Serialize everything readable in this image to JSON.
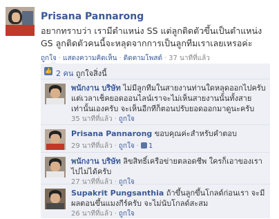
{
  "post": {
    "author": "Prisana Pannarong",
    "text": "อยากทราบว่า เรามีตำแหน่ง SS แต่ลูกติดตัวขึ้นเป็นตำแหน่ง GS ลูกติดตัวคนนี้จะหลุดจากการเป็นลูกทีมเราเลยเหรอค่ะ",
    "actions": {
      "like": "ถูกใจ",
      "comment": "แสดงความคิดเห็น",
      "follow": "ติดตามโพสต์",
      "time": "37 นาทีที่แล้ว"
    }
  },
  "likes_summary": {
    "count_text": "2 คน",
    "suffix": "ถูกใจสิ่งนี้"
  },
  "comments": [
    {
      "author": "พนักงาน บริษัท",
      "text": "ไม่มีลูกทีมในสายงานท่านใดหลุดออกไปครับแต่เวลาเช็คยอดออนไลน์เราจะไม่เห็นสายงานนั้นทั้งสายเท่านั้นเองครับ จะเห็นอีกทีก็ตอนปรับยอดออกมาดูนะครับ",
      "time": "35 นาทีที่แล้ว",
      "like_label": "ถูกใจ",
      "like_count": ""
    },
    {
      "author": "Prisana Pannarong",
      "text": "ขอบคุณค่ะสำหรับคำตอบ",
      "time": "29 นาทีที่แล้ว",
      "like_label": "ถูกใจ",
      "like_count": "1"
    },
    {
      "author": "พนักงาน บริษัท",
      "text": "ลิขสิทธิ์เครือข่ายตลอดชีพ ใครก็เอาของเราไปไม่ได้ครับ",
      "time": "27 นาทีที่แล้ว",
      "like_label": "ถูกใจ",
      "like_count": ""
    },
    {
      "author": "Supakrit Pungsanthia",
      "text": "ถ้าขึ้นลูกขึ้นโกลด์ก่อนเรา จะมีผลตอนขึ้นแมงกีร์ครับ จะไม่นับโกลด์สะสม",
      "time": "26 นาทีที่แล้ว",
      "like_label": "ถูกใจ",
      "like_count": ""
    }
  ],
  "colors": {
    "link": "#3b5998",
    "panel": "#eef0f5",
    "meta": "#888888"
  }
}
